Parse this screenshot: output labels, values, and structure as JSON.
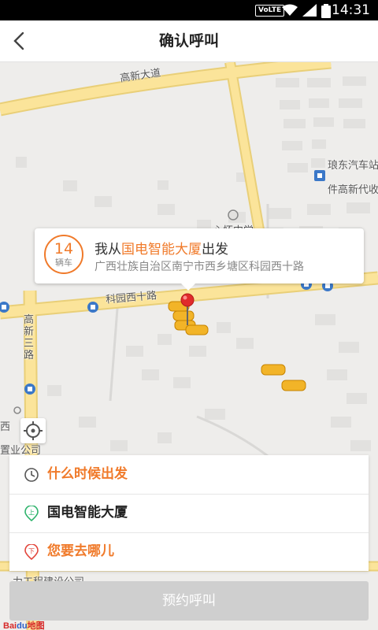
{
  "status_bar": {
    "network": "VoLTE",
    "time": "14:31",
    "wifi_icon": "wifi-icon",
    "signal_icon": "signal-icon",
    "battery_icon": "battery-icon"
  },
  "header": {
    "title": "确认呼叫",
    "back_icon": "back-arrow-icon"
  },
  "map": {
    "labels": {
      "road_gaoxin": "高新大道",
      "road_keyuan": "科园西十路",
      "road_gaoxin3": "高新三路",
      "poi_station": "琅东汽车站",
      "poi_agent": "件高新代收",
      "poi_school": "心怀中学",
      "poi_xi": "西",
      "poi_company": "置业公司",
      "poi_construction": "力工程建设公司"
    },
    "logo": {
      "text": "Bai",
      "paw": "du",
      "suffix": "地图"
    }
  },
  "info_bubble": {
    "car_count": "14",
    "car_unit": "辆车",
    "prefix": "我从",
    "place": "国电智能大厦",
    "suffix": "出发",
    "address": "广西壮族自治区南宁市西乡塘区科园西十路"
  },
  "form": {
    "time_label": "什么时候出发",
    "time_icon": "clock-icon",
    "pickup_label": "国电智能大厦",
    "pickup_icon": "pickup-pin-icon",
    "pickup_badge": "上",
    "dest_label": "您要去哪儿",
    "dest_icon": "dropoff-pin-icon",
    "dest_badge": "下"
  },
  "confirm_button": "预约呼叫",
  "colors": {
    "accent": "#f07a2a",
    "pickup_green": "#2db36b",
    "dropoff_red": "#e2443a",
    "button_disabled": "#cfcfcf",
    "road_yellow": "#fbe49a"
  }
}
